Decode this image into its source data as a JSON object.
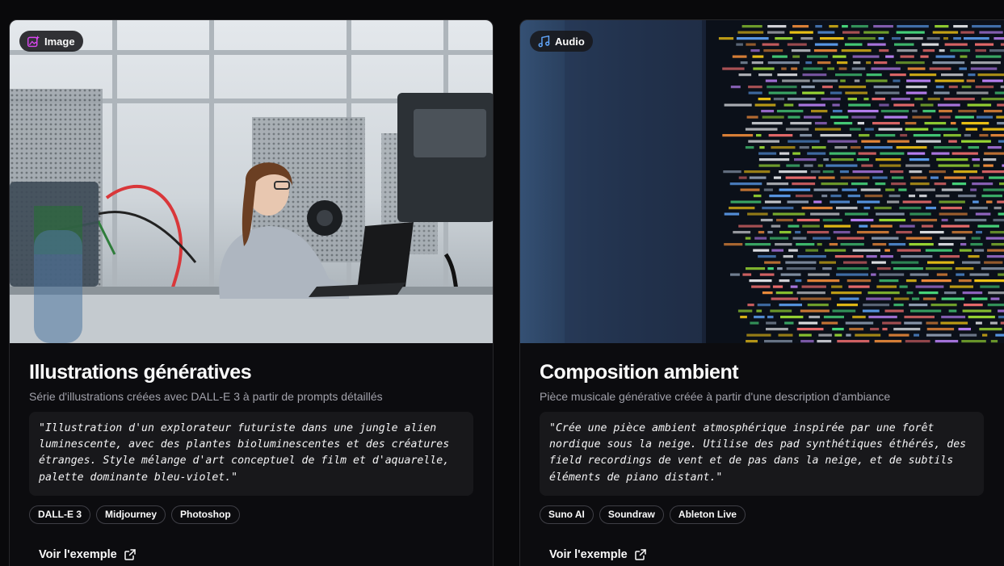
{
  "cards": [
    {
      "type_label": "Image",
      "type_icon": "image-sparkle-icon",
      "accent": "#d946ef",
      "title": "Illustrations génératives",
      "subtitle": "Série d'illustrations créées avec DALL-E 3 à partir de prompts détaillés",
      "prompt_lines": [
        "\"Illustration d'un explorateur futuriste dans une jungle alien",
        "luminescente, avec des plantes bioluminescentes et des créatures",
        "étranges. Style mélange d'art conceptuel de film et d'aquarelle,",
        "palette dominante bleu-violet.\""
      ],
      "tags": [
        "DALL-E 3",
        "Midjourney",
        "Photoshop"
      ],
      "link_label": "Voir l'exemple",
      "link_icon": "external-link-icon"
    },
    {
      "type_label": "Audio",
      "type_icon": "music-note-icon",
      "accent": "#60a5fa",
      "title": "Composition ambient",
      "subtitle": "Pièce musicale générative créée à partir d'une description d'ambiance",
      "prompt_lines": [
        "\"Crée une pièce ambient atmosphérique inspirée par une forêt",
        "nordique sous la neige. Utilise des pad synthétiques éthérés, des",
        "field recordings de vent et de pas dans la neige, et de subtils",
        "éléments de piano distant.\""
      ],
      "tags": [
        "Suno AI",
        "Soundraw",
        "Ableton Live"
      ],
      "link_label": "Voir l'exemple",
      "link_icon": "external-link-icon"
    }
  ]
}
